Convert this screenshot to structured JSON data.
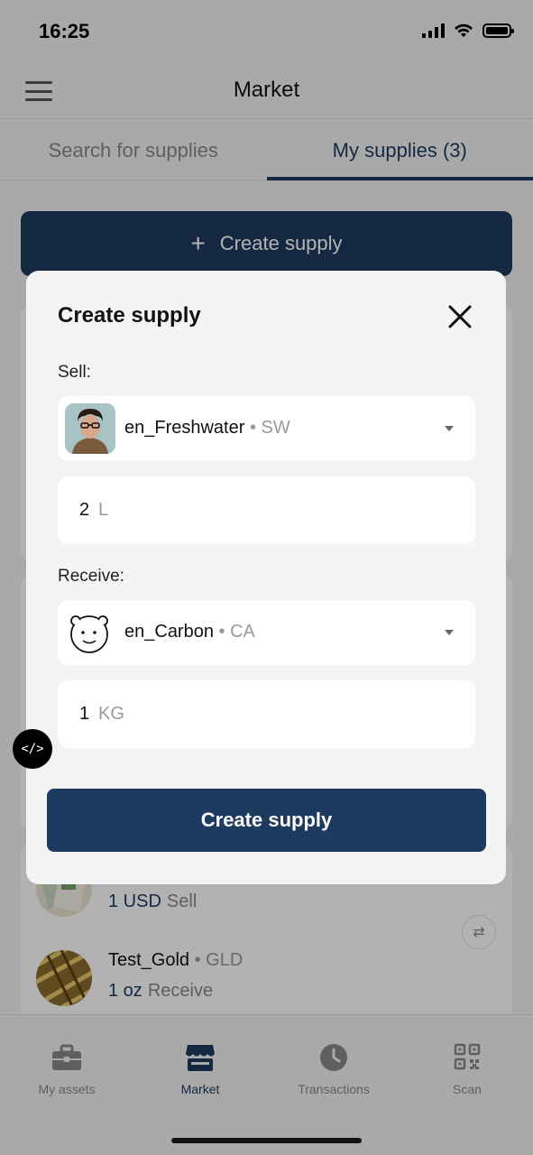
{
  "status_bar": {
    "time": "16:25"
  },
  "header": {
    "title": "Market"
  },
  "tabs": [
    {
      "label": "Search for supplies",
      "active": false
    },
    {
      "label": "My supplies (3)",
      "active": true
    }
  ],
  "background": {
    "create_button_label": "Create supply",
    "rows": [
      {
        "name": "",
        "code": "",
        "qty": "1 USD",
        "direction": "Sell"
      },
      {
        "name": "Test_Gold",
        "code": "• GLD",
        "qty": "1 oz",
        "direction": "Receive"
      }
    ]
  },
  "modal": {
    "title": "Create supply",
    "sell_label": "Sell:",
    "sell_asset": {
      "name": "en_Freshwater",
      "dot": "•",
      "code": "SW"
    },
    "sell_amount": {
      "value": "2",
      "unit": "L"
    },
    "receive_label": "Receive:",
    "receive_asset": {
      "name": "en_Carbon",
      "dot": "•",
      "code": "CA"
    },
    "receive_amount": {
      "value": "1",
      "unit": "KG"
    },
    "submit_label": "Create supply"
  },
  "bottom_nav": [
    {
      "label": "My assets",
      "icon": "briefcase-icon",
      "active": false
    },
    {
      "label": "Market",
      "icon": "store-icon",
      "active": true
    },
    {
      "label": "Transactions",
      "icon": "clock-icon",
      "active": false
    },
    {
      "label": "Scan",
      "icon": "qr-code-icon",
      "active": false
    }
  ],
  "dev_badge": "</>",
  "colors": {
    "primary": "#1d3a5f",
    "overlay": "rgba(0,0,0,0.3)",
    "muted": "#888888"
  }
}
